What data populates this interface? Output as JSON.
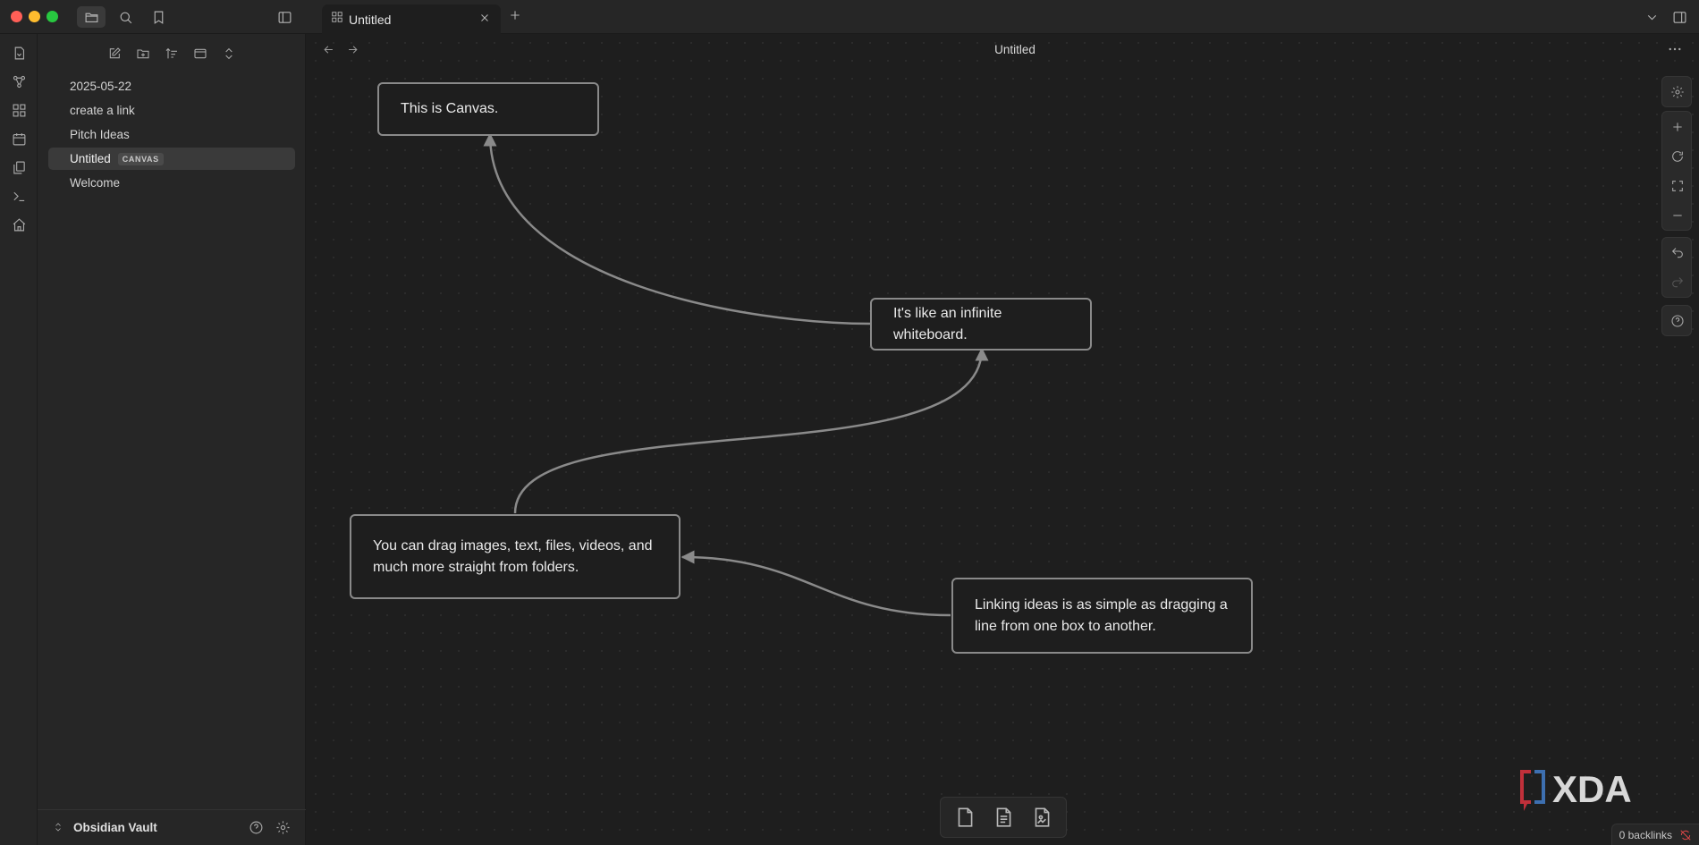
{
  "tab": {
    "title": "Untitled"
  },
  "sidebar": {
    "files": [
      {
        "name": "2025-05-22",
        "badge": ""
      },
      {
        "name": "create a link",
        "badge": ""
      },
      {
        "name": "Pitch Ideas",
        "badge": ""
      },
      {
        "name": "Untitled",
        "badge": "CANVAS",
        "active": true
      },
      {
        "name": "Welcome",
        "badge": ""
      }
    ],
    "vault_name": "Obsidian Vault"
  },
  "main": {
    "view_title": "Untitled"
  },
  "canvas": {
    "cards": [
      {
        "text": "This is Canvas."
      },
      {
        "text": "It's like an infinite whiteboard."
      },
      {
        "text": "You can drag images, text, files, videos, and much more straight from folders."
      },
      {
        "text": "Linking ideas is as simple as dragging a line from one box to another."
      }
    ]
  },
  "watermark": {
    "text": "XDA"
  },
  "status": {
    "backlinks": "0 backlinks"
  },
  "colors": {
    "background": "#1e1e1e",
    "sidebar": "#262626",
    "card_border": "#8a8a8a",
    "edge": "#8a8a8a",
    "accent_red": "#e04848"
  }
}
